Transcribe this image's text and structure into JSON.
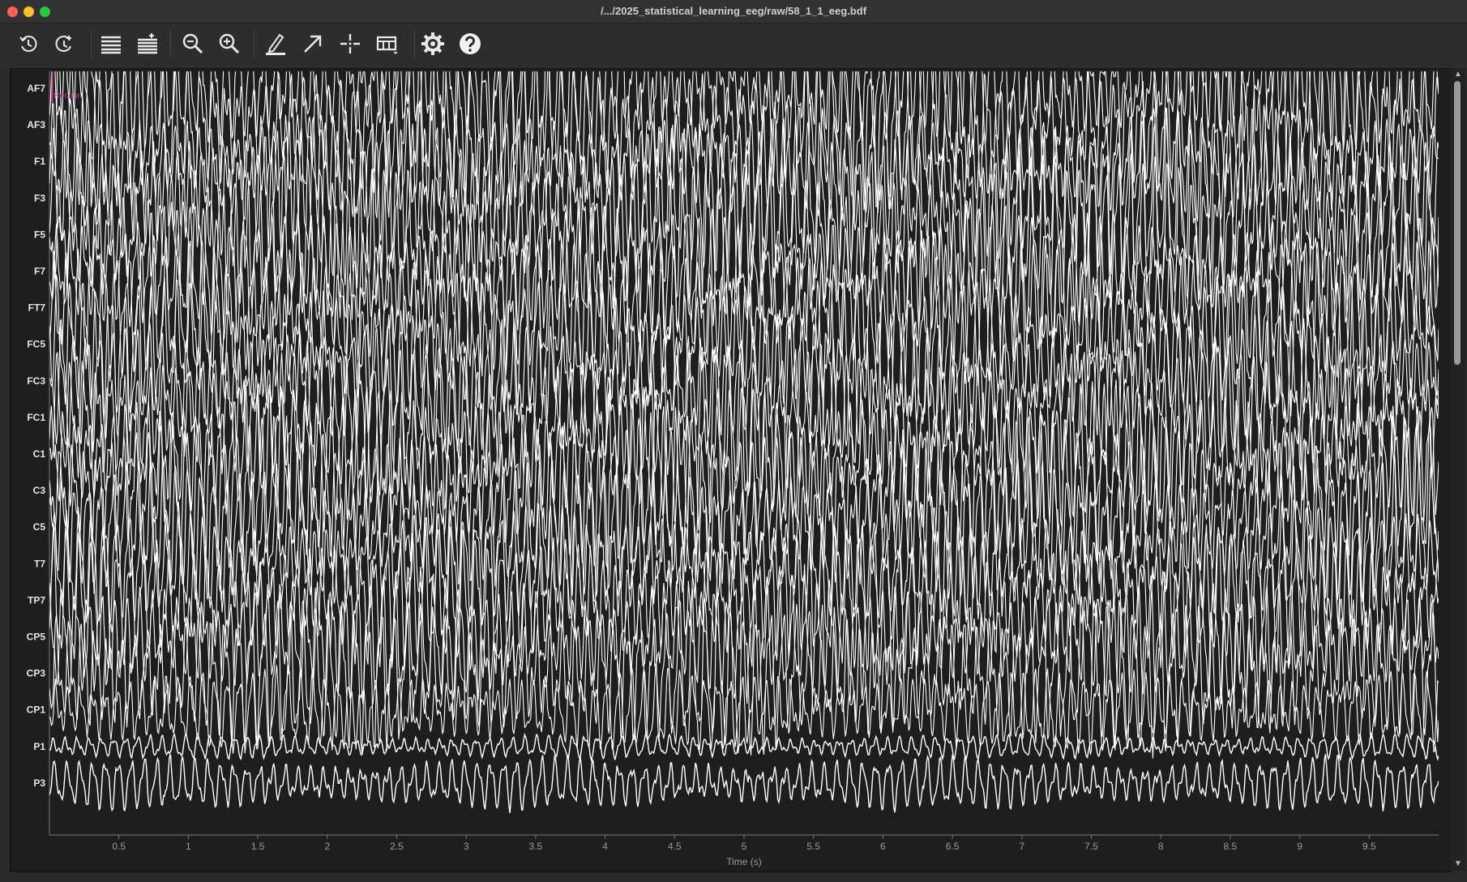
{
  "window": {
    "title": "/.../2025_statistical_learning_eeg/raw/58_1_1_eeg.bdf"
  },
  "toolbar": {
    "buttons": [
      {
        "name": "scroll-back-icon",
        "label": "Scroll back"
      },
      {
        "name": "scroll-forward-icon",
        "label": "Scroll forward"
      },
      {
        "name": "fewer-channels-icon",
        "label": "Fewer channels"
      },
      {
        "name": "more-channels-icon",
        "label": "More channels"
      },
      {
        "name": "zoom-out-icon",
        "label": "Zoom out"
      },
      {
        "name": "zoom-in-icon",
        "label": "Zoom in"
      },
      {
        "name": "annotation-mode-icon",
        "label": "Annotation mode"
      },
      {
        "name": "scalebar-icon",
        "label": "Toggle scalebars"
      },
      {
        "name": "crosshair-icon",
        "label": "Crosshair"
      },
      {
        "name": "projectors-icon",
        "label": "Projectors"
      },
      {
        "name": "settings-icon",
        "label": "Settings"
      },
      {
        "name": "help-icon",
        "label": "Help"
      }
    ]
  },
  "colors": {
    "background": "#1e1e1e",
    "trace": "#ffffff",
    "annotation": "#c2469a",
    "axis": "#7a7a7a"
  },
  "chart_data": {
    "type": "line",
    "channels": [
      "AF7",
      "AF3",
      "F1",
      "F3",
      "F5",
      "F7",
      "FT7",
      "FC5",
      "FC3",
      "FC1",
      "C1",
      "C3",
      "C5",
      "T7",
      "TP7",
      "CP5",
      "CP3",
      "CP1",
      "P1",
      "P3"
    ],
    "xlabel": "Time (s)",
    "xlim": [
      0,
      10
    ],
    "xticks": [
      0.5,
      1,
      1.5,
      2,
      2.5,
      3,
      3.5,
      4,
      4.5,
      5,
      5.5,
      6,
      6.5,
      7,
      7.5,
      8,
      8.5,
      9,
      9.5
    ],
    "xtick_labels": [
      "0.5",
      "1",
      "1.5",
      "2",
      "2.5",
      "3",
      "3.5",
      "4",
      "4.5",
      "5",
      "5.5",
      "6",
      "6.5",
      "7",
      "7.5",
      "8",
      "8.5",
      "9",
      "9.5"
    ],
    "annotation": {
      "onset": 0.02,
      "label": "Recoun"
    }
  }
}
